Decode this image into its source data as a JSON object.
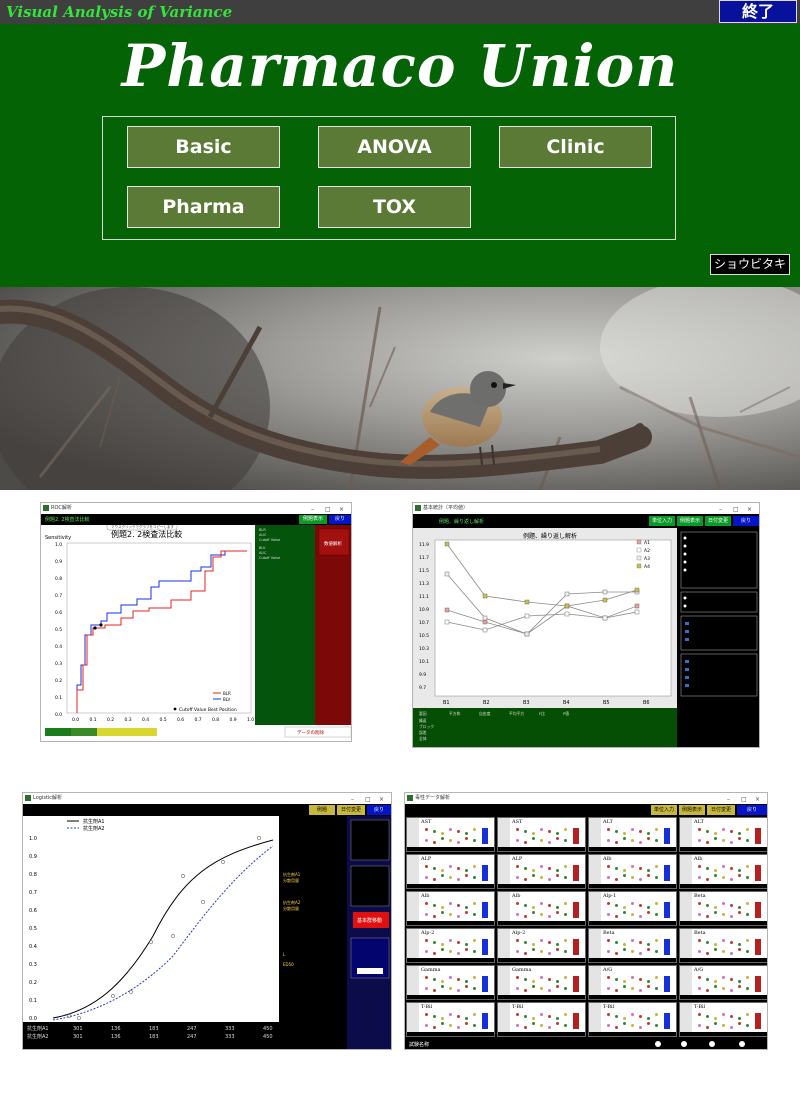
{
  "topbar": {
    "title": "Visual  Analysis of Variance",
    "exit_label": "終了"
  },
  "header": {
    "brand": "Pharmaco Union",
    "menu": [
      {
        "label": "Basic"
      },
      {
        "label": "ANOVA"
      },
      {
        "label": "Clinic"
      },
      {
        "label": "Pharma"
      },
      {
        "label": "TOX"
      }
    ],
    "bird_button": "ショウビタキ"
  },
  "thumbnails": {
    "roc": {
      "window_title": "ROC解析",
      "tab_title": "例題2. 2検査法比較",
      "chart_title": "例題2. 2検査法比較",
      "tooltip": "マウスクリックでグラフをコピーします",
      "ylabel": "Sensitivity",
      "ticks_y": [
        "1.0",
        "0.9",
        "0.8",
        "0.7",
        "0.6",
        "0.5",
        "0.4",
        "0.3",
        "0.2",
        "0.1",
        "0.0"
      ],
      "ticks_x": [
        "0.0",
        "0.1",
        "0.2",
        "0.3",
        "0.4",
        "0.5",
        "0.6",
        "0.7",
        "0.8",
        "0.9",
        "1.0"
      ],
      "legend": [
        "BLR",
        "BLV"
      ],
      "cutoff_label": "Cutoff Value Best Position",
      "buttons": [
        "例題表示",
        "戻り"
      ],
      "red_button": "数値解析",
      "data_button": "データの削除"
    },
    "anova": {
      "window_title": "基本統計（平均値）",
      "tab_title": "例題、繰り返し解析",
      "chart_title": "例題、繰り返し解析",
      "buttons": [
        "単位入力",
        "例題表示",
        "日付変更",
        "戻り"
      ],
      "ticks_y": [
        "11.9",
        "11.7",
        "11.5",
        "11.3",
        "11.1",
        "10.9",
        "10.7",
        "10.5",
        "10.3",
        "10.1",
        "9.9",
        "9.7"
      ],
      "ticks_x": [
        "B1",
        "B2",
        "B3",
        "B4",
        "B5",
        "B6"
      ],
      "legend": [
        "A1",
        "A2",
        "A3",
        "A4"
      ]
    },
    "logistic": {
      "window_title": "Logistic解析",
      "buttons": [
        "例題",
        "日付変更",
        "戻り"
      ],
      "legend": [
        "抗生剤A1",
        "抗生剤A2"
      ],
      "ticks_y": [
        "1.0",
        "0.9",
        "0.8",
        "0.7",
        "0.6",
        "0.5",
        "0.4",
        "0.3",
        "0.2",
        "0.1",
        "0.0"
      ],
      "row_labels": [
        "抗生剤A1",
        "抗生剤A2"
      ],
      "doses": [
        "301",
        "136",
        "183",
        "247",
        "333",
        "450"
      ],
      "red_button": "基本群移動"
    },
    "tox": {
      "window_title": "毒性データ解析",
      "buttons": [
        "単位入力",
        "例題表示",
        "日付変更",
        "戻り"
      ],
      "panels": [
        "AST",
        "AST",
        "ALT",
        "ALT",
        "ALP",
        "ALP",
        "Alb",
        "Alb",
        "Alb",
        "Alb",
        "Alp-1",
        "Beta",
        "Alp-2",
        "Alp-2",
        "Beta",
        "Beta",
        "Gamma",
        "Gamma",
        "A/G",
        "A/G",
        "T-Bil",
        "T-Bil",
        "T-Bil",
        "T-Bil"
      ],
      "footer": "試験名称"
    }
  }
}
